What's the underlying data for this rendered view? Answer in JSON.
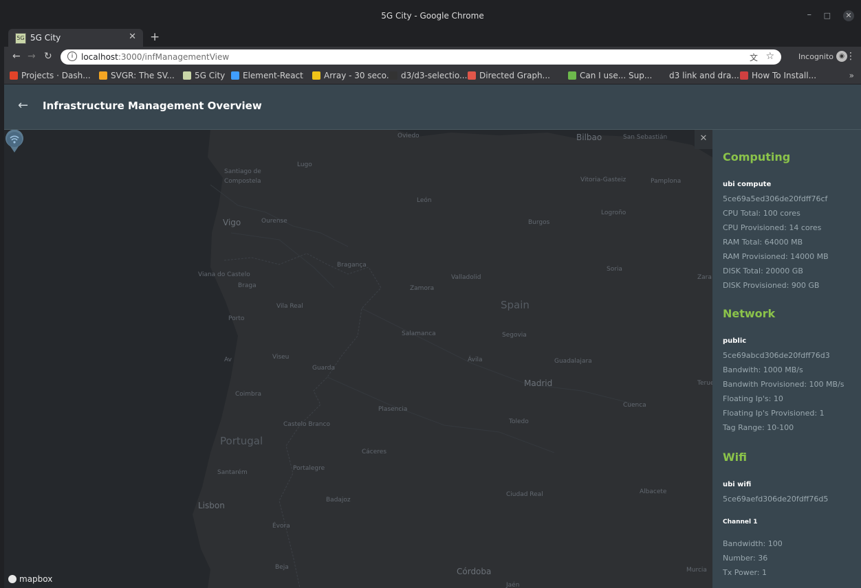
{
  "browser": {
    "window_title": "5G City - Google Chrome",
    "tab_title": "5G City",
    "tab_favicon": "5G",
    "url_host": "localhost",
    "url_rest": ":3000/infManagementView",
    "incognito_label": "Incognito",
    "bookmarks": [
      {
        "label": "Projects · Dash...",
        "icon": "gitlab-icon",
        "color": "#e24329"
      },
      {
        "label": "SVGR: The SV...",
        "icon": "svgr-icon",
        "color": "#f5a623"
      },
      {
        "label": "5G City",
        "icon": "5gcity-icon",
        "color": "#c9d6a8"
      },
      {
        "label": "Element-React",
        "icon": "element-icon",
        "color": "#409eff"
      },
      {
        "label": "Array - 30 seco...",
        "icon": "info-icon",
        "color": "#f0c419"
      },
      {
        "label": "d3/d3-selectio...",
        "icon": "github-icon",
        "color": "#333333"
      },
      {
        "label": "Directed Graph...",
        "icon": "graph-icon",
        "color": "#e0564a"
      },
      {
        "label": "Can I use... Sup...",
        "icon": "caniuse-icon",
        "color": "#6db94c"
      },
      {
        "label": "d3 link and dra...",
        "icon": "d3-icon",
        "color": "#35363a"
      },
      {
        "label": "How To Install...",
        "icon": "install-icon",
        "color": "#d04040"
      }
    ]
  },
  "app": {
    "title": "Infrastructure Management Overview"
  },
  "map": {
    "attribution": "mapbox",
    "places": [
      {
        "name": "Oviedo",
        "size": "small"
      },
      {
        "name": "Bilbao",
        "size": "mid"
      },
      {
        "name": "San Sebastián",
        "size": "small"
      },
      {
        "name": "Lugo",
        "size": "small"
      },
      {
        "name": "Santiago de",
        "size": "small"
      },
      {
        "name": "Compostela",
        "size": "small"
      },
      {
        "name": "Vitoria-Gasteiz",
        "size": "small"
      },
      {
        "name": "Pamplona",
        "size": "small"
      },
      {
        "name": "León",
        "size": "small"
      },
      {
        "name": "Logroño",
        "size": "small"
      },
      {
        "name": "Vigo",
        "size": "mid"
      },
      {
        "name": "Ourense",
        "size": "small"
      },
      {
        "name": "Burgos",
        "size": "small"
      },
      {
        "name": "Bragança",
        "size": "small"
      },
      {
        "name": "Soria",
        "size": "small"
      },
      {
        "name": "Viana do Castelo",
        "size": "small"
      },
      {
        "name": "Braga",
        "size": "small"
      },
      {
        "name": "Valladolid",
        "size": "small"
      },
      {
        "name": "Zara",
        "size": "small"
      },
      {
        "name": "Zamora",
        "size": "small"
      },
      {
        "name": "Vila Real",
        "size": "small"
      },
      {
        "name": "Spain",
        "size": "big"
      },
      {
        "name": "Porto",
        "size": "small"
      },
      {
        "name": "Salamanca",
        "size": "small"
      },
      {
        "name": "Segovia",
        "size": "small"
      },
      {
        "name": "Viseu",
        "size": "small"
      },
      {
        "name": "Ávila",
        "size": "small"
      },
      {
        "name": "Guadalajara",
        "size": "small"
      },
      {
        "name": "Guarda",
        "size": "small"
      },
      {
        "name": "Madrid",
        "size": "mid"
      },
      {
        "name": "Teruel",
        "size": "small"
      },
      {
        "name": "Coimbra",
        "size": "small"
      },
      {
        "name": "Plasencia",
        "size": "small"
      },
      {
        "name": "Cuenca",
        "size": "small"
      },
      {
        "name": "Toledo",
        "size": "small"
      },
      {
        "name": "Castelo Branco",
        "size": "small"
      },
      {
        "name": "Portugal",
        "size": "big"
      },
      {
        "name": "Cáceres",
        "size": "small"
      },
      {
        "name": "Santarém",
        "size": "small"
      },
      {
        "name": "Portalegre",
        "size": "small"
      },
      {
        "name": "Ciudad Real",
        "size": "small"
      },
      {
        "name": "Albacete",
        "size": "small"
      },
      {
        "name": "Badajoz",
        "size": "small"
      },
      {
        "name": "Lisbon",
        "size": "mid"
      },
      {
        "name": "Évora",
        "size": "small"
      },
      {
        "name": "Beja",
        "size": "small"
      },
      {
        "name": "Córdoba",
        "size": "mid"
      },
      {
        "name": "Murcia",
        "size": "small"
      },
      {
        "name": "Jaén",
        "size": "small"
      },
      {
        "name": "Av",
        "size": "small"
      }
    ]
  },
  "panel": {
    "computing": {
      "heading": "Computing",
      "name": "ubi compute",
      "id": "5ce69a5ed306de20fdff76cf",
      "lines": [
        "CPU Total: 100 cores",
        "CPU Provisioned: 14 cores",
        "RAM Total: 64000 MB",
        "RAM Provisioned: 14000 MB",
        "DISK Total: 20000 GB",
        "DISK Provisioned: 900 GB"
      ]
    },
    "network": {
      "heading": "Network",
      "name": "public",
      "id": "5ce69abcd306de20fdff76d3",
      "lines": [
        "Bandwith: 1000 MB/s",
        "Bandwith Provisioned: 100 MB/s",
        "Floating Ip's: 10",
        "Floating Ip's Provisioned: 1",
        "Tag Range: 10-100"
      ]
    },
    "wifi": {
      "heading": "Wifi",
      "name": "ubi wifi",
      "id": "5ce69aefd306de20fdff76d5",
      "channel": "Channel 1",
      "lines": [
        "Bandwidth: 100",
        "Number: 36",
        "Tx Power: 1"
      ]
    }
  }
}
